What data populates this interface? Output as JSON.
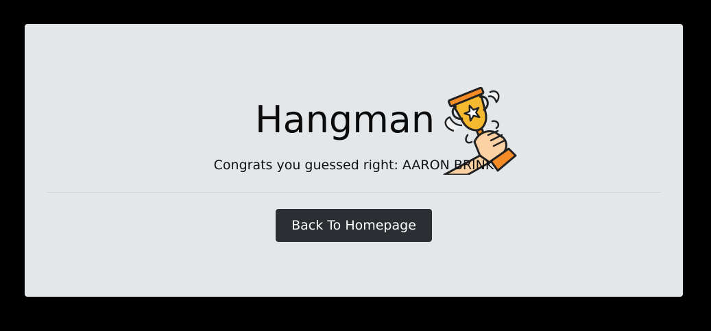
{
  "title": "Hangman",
  "message": "Congrats you guessed right: AARON BRINK",
  "back_button_label": "Back To Homepage",
  "icons": {
    "trophy": "trophy-in-hand-icon"
  },
  "colors": {
    "page_background": "#000000",
    "card_background": "#e4e7ea",
    "button_background": "#2b2f33",
    "button_text": "#ffffff",
    "trophy_gold": "#f5b82e",
    "trophy_orange": "#f58b25",
    "skin": "#fcd1a4"
  }
}
